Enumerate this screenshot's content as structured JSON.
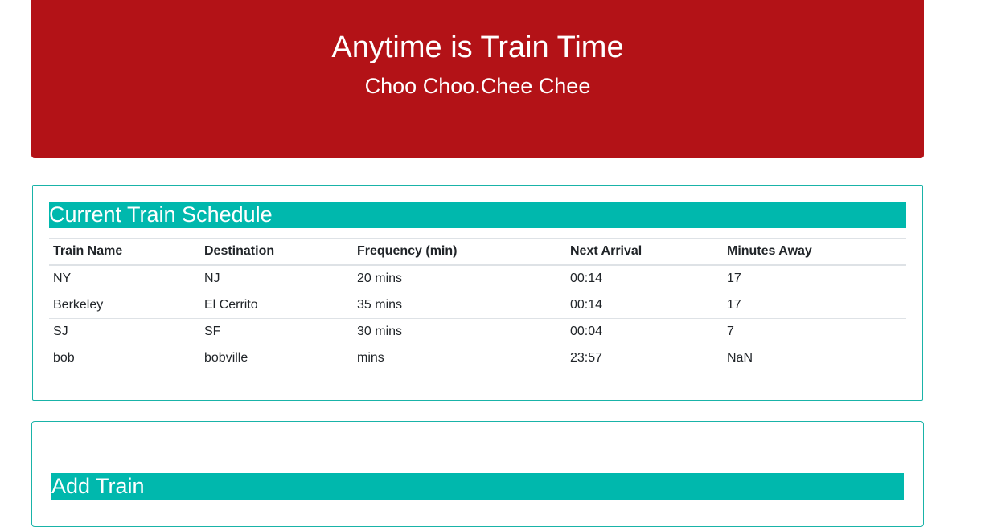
{
  "header": {
    "title": "Anytime is Train Time",
    "subtitle": "Choo Choo.Chee Chee"
  },
  "schedule": {
    "heading": "Current Train Schedule",
    "columns": [
      "Train Name",
      "Destination",
      "Frequency (min)",
      "Next Arrival",
      "Minutes Away"
    ],
    "rows": [
      [
        "NY",
        "NJ",
        "20 mins",
        "00:14",
        "17"
      ],
      [
        "Berkeley",
        "El Cerrito",
        "35 mins",
        "00:14",
        "17"
      ],
      [
        "SJ",
        "SF",
        "30 mins",
        "00:04",
        "7"
      ],
      [
        "bob",
        "bobville",
        "mins",
        "23:57",
        "NaN"
      ]
    ]
  },
  "add_train": {
    "heading": "Add Train"
  },
  "colors": {
    "header_bg": "#b31217",
    "accent": "#00b8ad",
    "panel_border": "#19b3a8"
  }
}
